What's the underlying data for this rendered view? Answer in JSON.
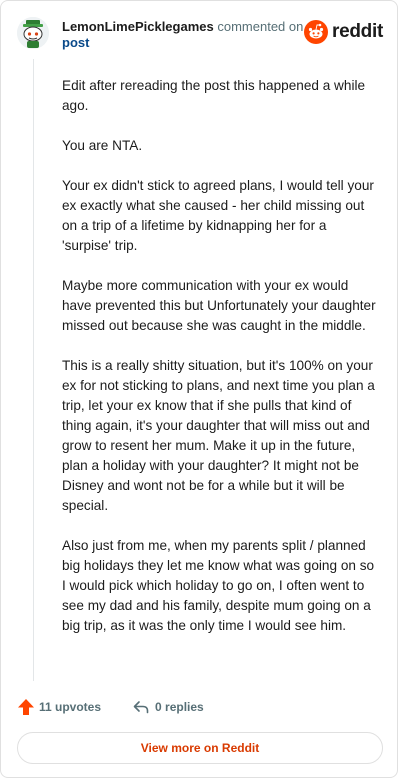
{
  "header": {
    "username": "LemonLimePicklegames",
    "commented": "commented on",
    "post_link": "post",
    "brand": "reddit"
  },
  "comment": {
    "paragraphs": [
      "Edit after rereading the post this happened a while ago.",
      "You are NTA.",
      "Your ex didn't stick to agreed plans, I would tell your ex exactly what she caused - her child missing out on a trip of a lifetime by kidnapping her for a 'surpise' trip.",
      "Maybe more communication with your ex would have prevented this but Unfortunately your daughter missed out because she was caught in the middle.",
      "This is a really shitty situation, but it's 100% on your ex for not sticking to plans, and next time you plan a trip, let your ex know that if she pulls that kind of thing again, it's your daughter that will miss out and grow to resent her mum. Make it up in the future, plan a holiday with your daughter? It might not be Disney and wont not be for a while but it will be special.",
      "Also just from me, when my parents split / planned big holidays they let me know what was going on so I would pick which holiday to go on, I often went to see my dad and his family, despite mum going on a big trip, as it was the only time I would see him."
    ]
  },
  "footer": {
    "upvotes": "11 upvotes",
    "replies": "0 replies",
    "view_more": "View more on Reddit"
  },
  "colors": {
    "brand_orange": "#ff4500",
    "link_orange": "#d93a00",
    "link_blue": "#0a4a8a"
  }
}
